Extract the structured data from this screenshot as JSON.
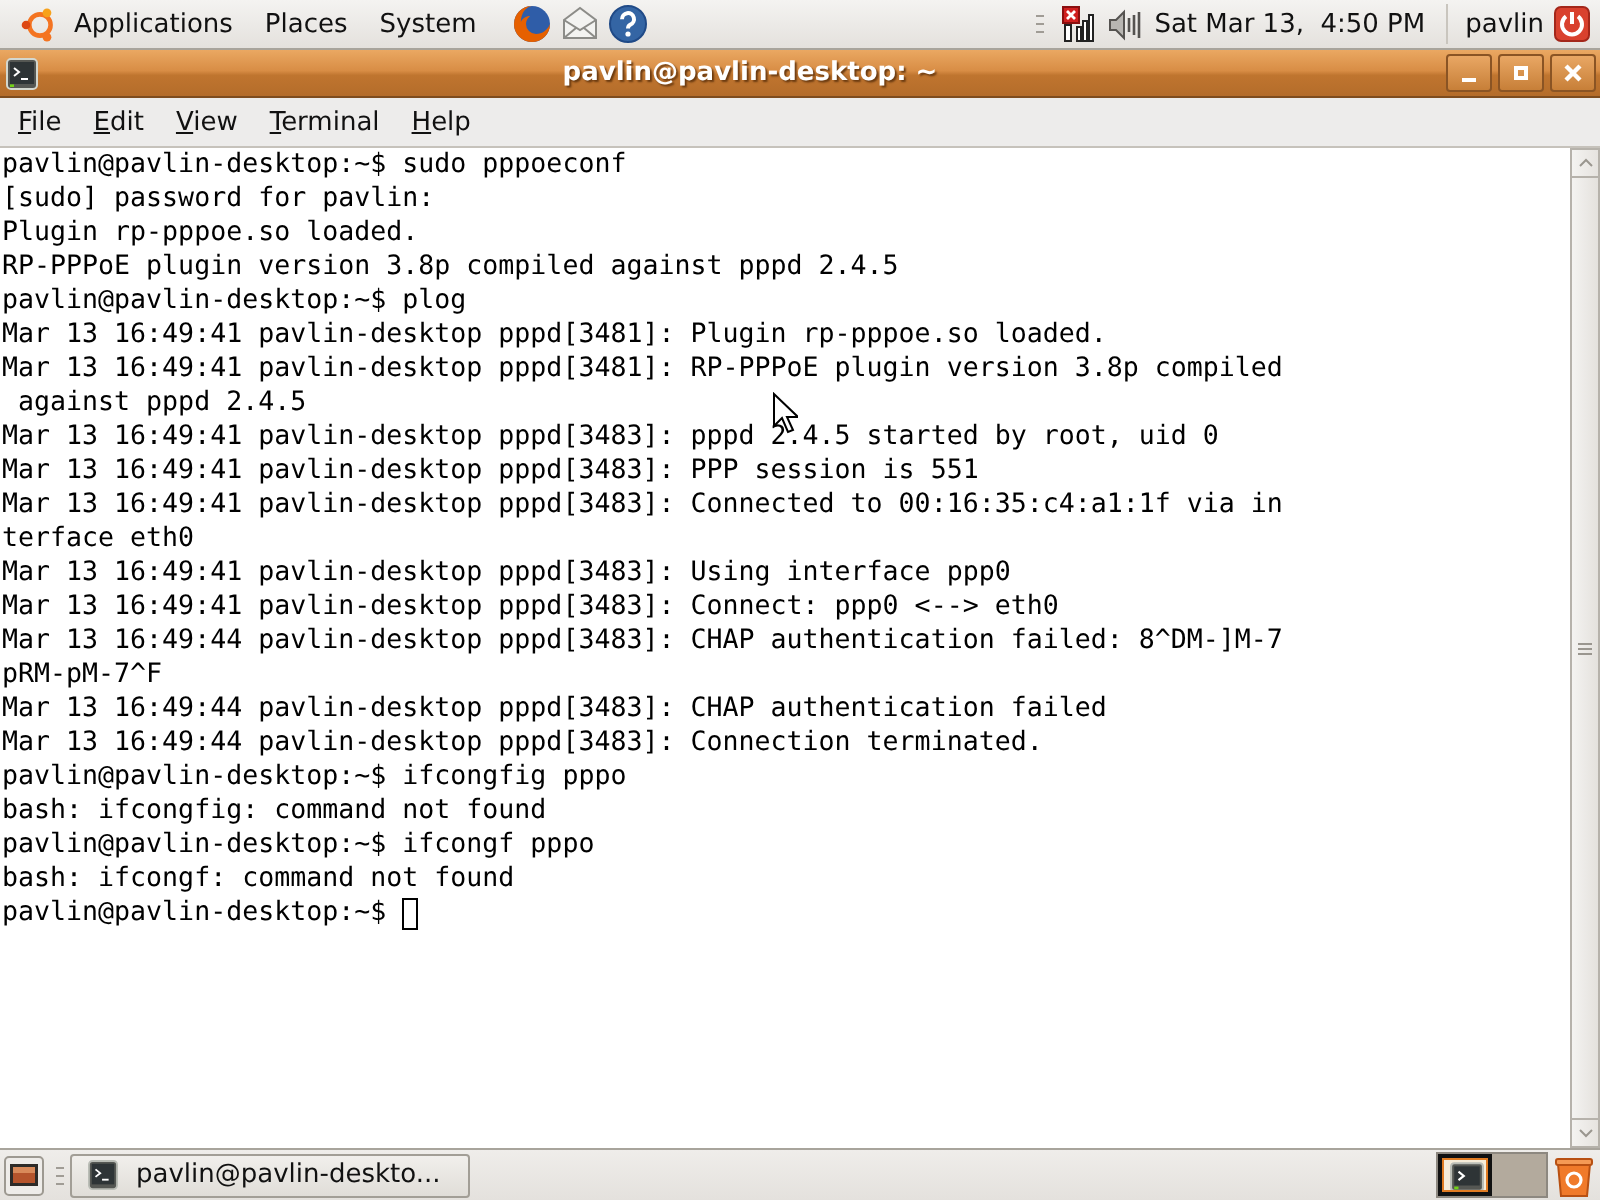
{
  "top_panel": {
    "menus": [
      "Applications",
      "Places",
      "System"
    ],
    "clock": "Sat Mar 13,  4:50 PM",
    "user": "pavlin"
  },
  "window": {
    "title": "pavlin@pavlin-desktop: ~",
    "menu": [
      "File",
      "Edit",
      "View",
      "Terminal",
      "Help"
    ]
  },
  "terminal": {
    "lines": [
      "pavlin@pavlin-desktop:~$ sudo pppoeconf",
      "[sudo] password for pavlin:",
      "Plugin rp-pppoe.so loaded.",
      "RP-PPPoE plugin version 3.8p compiled against pppd 2.4.5",
      "pavlin@pavlin-desktop:~$ plog",
      "Mar 13 16:49:41 pavlin-desktop pppd[3481]: Plugin rp-pppoe.so loaded.",
      "Mar 13 16:49:41 pavlin-desktop pppd[3481]: RP-PPPoE plugin version 3.8p compiled",
      " against pppd 2.4.5",
      "Mar 13 16:49:41 pavlin-desktop pppd[3483]: pppd 2.4.5 started by root, uid 0",
      "Mar 13 16:49:41 pavlin-desktop pppd[3483]: PPP session is 551",
      "Mar 13 16:49:41 pavlin-desktop pppd[3483]: Connected to 00:16:35:c4:a1:1f via in",
      "terface eth0",
      "Mar 13 16:49:41 pavlin-desktop pppd[3483]: Using interface ppp0",
      "Mar 13 16:49:41 pavlin-desktop pppd[3483]: Connect: ppp0 <--> eth0",
      "Mar 13 16:49:44 pavlin-desktop pppd[3483]: CHAP authentication failed: 8^DM-]M-7",
      "pRM-pM-7^F",
      "Mar 13 16:49:44 pavlin-desktop pppd[3483]: CHAP authentication failed",
      "Mar 13 16:49:44 pavlin-desktop pppd[3483]: Connection terminated.",
      "pavlin@pavlin-desktop:~$ ifcongfig pppo",
      "bash: ifcongfig: command not found",
      "pavlin@pavlin-desktop:~$ ifcongf pppo",
      "bash: ifcongf: command not found"
    ],
    "prompt": "pavlin@pavlin-desktop:~$"
  },
  "bottom_panel": {
    "tasks": [
      "pavlin@pavlin-deskto..."
    ],
    "workspaces": [
      {
        "selected": true,
        "has_window": true
      },
      {
        "selected": false,
        "has_window": false
      }
    ]
  }
}
